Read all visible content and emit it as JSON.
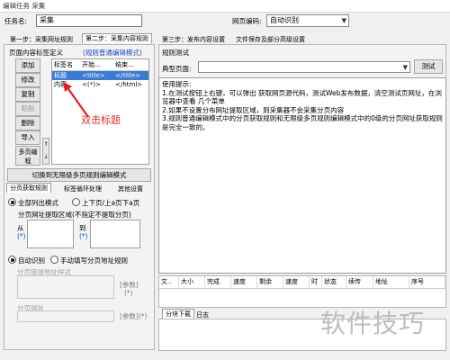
{
  "window": {
    "title": "编辑任务 采集"
  },
  "task": {
    "name_label": "任务名:",
    "name_value": "采集",
    "encoding_label": "网页编码:",
    "encoding_value": "自动识别"
  },
  "steps": {
    "tab1": "第一步：采集网址规则",
    "tab2": "第二步：采集内容规则",
    "tab3": "第三步：发布内容设置",
    "tab4": "文件保存及部分高级设置"
  },
  "tags": {
    "header": "页面内容标签定义",
    "mode": "(规则普通编辑模式)",
    "buttons": [
      "添加",
      "修改",
      "复制",
      "粘贴",
      "删除",
      "导入"
    ],
    "more_button": "多页编程",
    "columns": [
      "标签名",
      "开始...",
      "结束..."
    ],
    "rows": [
      {
        "name": "标题",
        "start": "<title>",
        "end": "</title>"
      },
      {
        "name": "内容",
        "start": "<(*)>",
        "end": "</html>"
      }
    ],
    "annotation": "双击标题",
    "switch_button": "切换到无限级多页规则编辑模式"
  },
  "paging": {
    "tabs": [
      "分页获取规则",
      "标签循环处理",
      "其他设置"
    ],
    "option_full": "全部列出模式",
    "option_prevnext": "上下页/上a页下a页",
    "region_label": "分页网址提取区域(不指定不提取分页)",
    "from_label": "从",
    "to_label": "到",
    "from_token": "(*)",
    "to_token": "(*)",
    "mode_auto": "自动识别",
    "mode_manual": "手动填写分页地址规则",
    "link_label": "分页链接地址样式",
    "param_label": "[参数]",
    "star_token": "(*)",
    "url_label": "分页网址",
    "param_star_label": "[参数](*)"
  },
  "rule_test": {
    "header": "规则测试",
    "page_label": "典型页面:",
    "page_value": "",
    "test_button": "测试",
    "tips": [
      "使用提示:",
      "1.在测试按钮上右键，可以弹出 获取网页源代码，测试Web发布数据，清空测试页网址，在浏览器中查看 几个菜单",
      "2.如果不设置分布网址提取区域，则采集器不会采集分页内容",
      "3.规则普通编辑模式中的分页获取规则和无限级多页规则编辑模式中的0级的分页网址获取规则是完全一致的。"
    ]
  },
  "download_grid": {
    "columns": [
      "文..",
      "大小",
      "完成",
      "速度",
      "剩余",
      "速度",
      "时",
      "状态",
      "续传",
      "地址",
      "序号"
    ],
    "tabs": [
      "分块下载",
      "日志"
    ]
  },
  "watermark": {
    "text": "软件技巧"
  }
}
